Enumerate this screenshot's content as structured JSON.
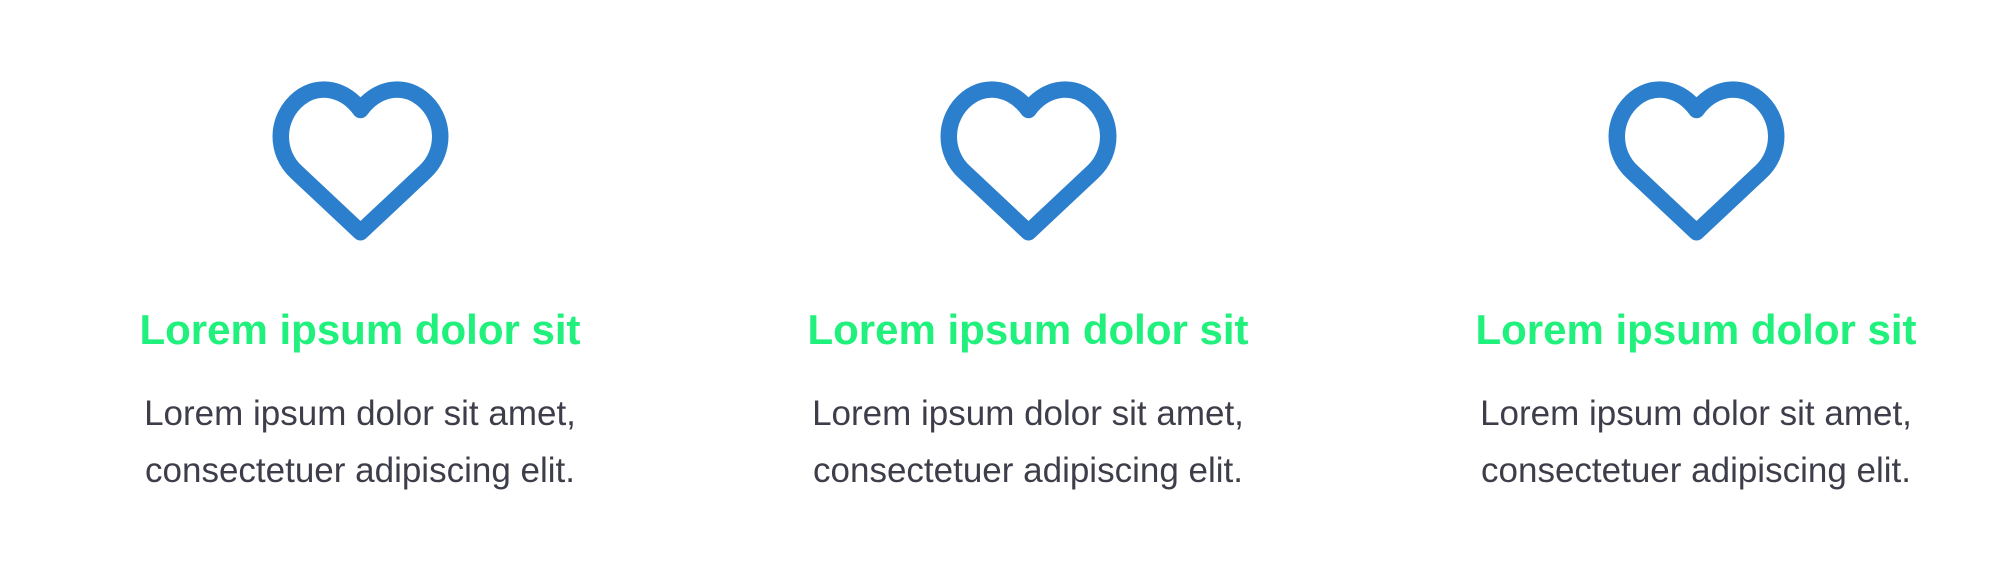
{
  "theme": {
    "icon_color": "#2b7fcc",
    "title_color": "#20f07c",
    "text_color": "#3e3e4a"
  },
  "features": [
    {
      "icon": "heart-outline-icon",
      "title": "Lorem ipsum dolor sit",
      "desc_line1": "Lorem ipsum dolor sit amet,",
      "desc_line2": "consectetuer adipiscing elit."
    },
    {
      "icon": "heart-outline-icon",
      "title": "Lorem ipsum dolor sit",
      "desc_line1": "Lorem ipsum dolor sit amet,",
      "desc_line2": "consectetuer adipiscing elit."
    },
    {
      "icon": "heart-outline-icon",
      "title": "Lorem ipsum dolor sit",
      "desc_line1": "Lorem ipsum dolor sit amet,",
      "desc_line2": "consectetuer adipiscing elit."
    }
  ]
}
